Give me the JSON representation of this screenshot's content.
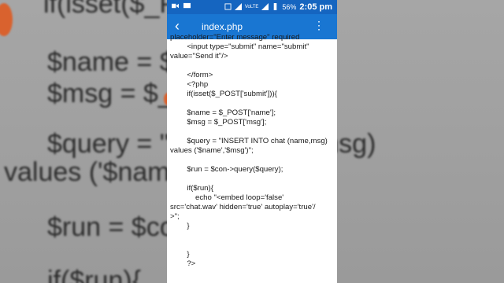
{
  "background_zoom": {
    "lines": [
      "if(isset($_P",
      "$name = $_",
      "$msg = $_P",
      "$query = \"IN                        at (name,msg)",
      "values ('$name",
      "$run = $co                       );",
      "if($run){"
    ]
  },
  "status_bar": {
    "time": "2:05 pm",
    "battery": "56%",
    "network": "VoLTE"
  },
  "app_bar": {
    "title": "index.php"
  },
  "code_lines": [
    "placeholder=\"Enter message\" required",
    "        <input type=\"submit\" name=\"submit\"",
    "value=\"Send it\"/>",
    "",
    "        </form>",
    "        <?php",
    "        if(isset($_POST['submit'])){",
    "",
    "        $name = $_POST['name'];",
    "        $msg = $_POST['msg'];",
    "",
    "        $query = \"INSERT INTO chat (name,msg)",
    "values ('$name','$msg')\";",
    "",
    "        $run = $con->query($query);",
    "",
    "        if($run){",
    "            echo \"<embed loop='false'",
    "src='chat.wav' hidden='true' autoplay='true'/",
    ">\";",
    "        }",
    "",
    "",
    "        }",
    "        ?>",
    ""
  ],
  "colors": {
    "status_bar": "#1565c0",
    "app_bar": "#1976d2"
  }
}
